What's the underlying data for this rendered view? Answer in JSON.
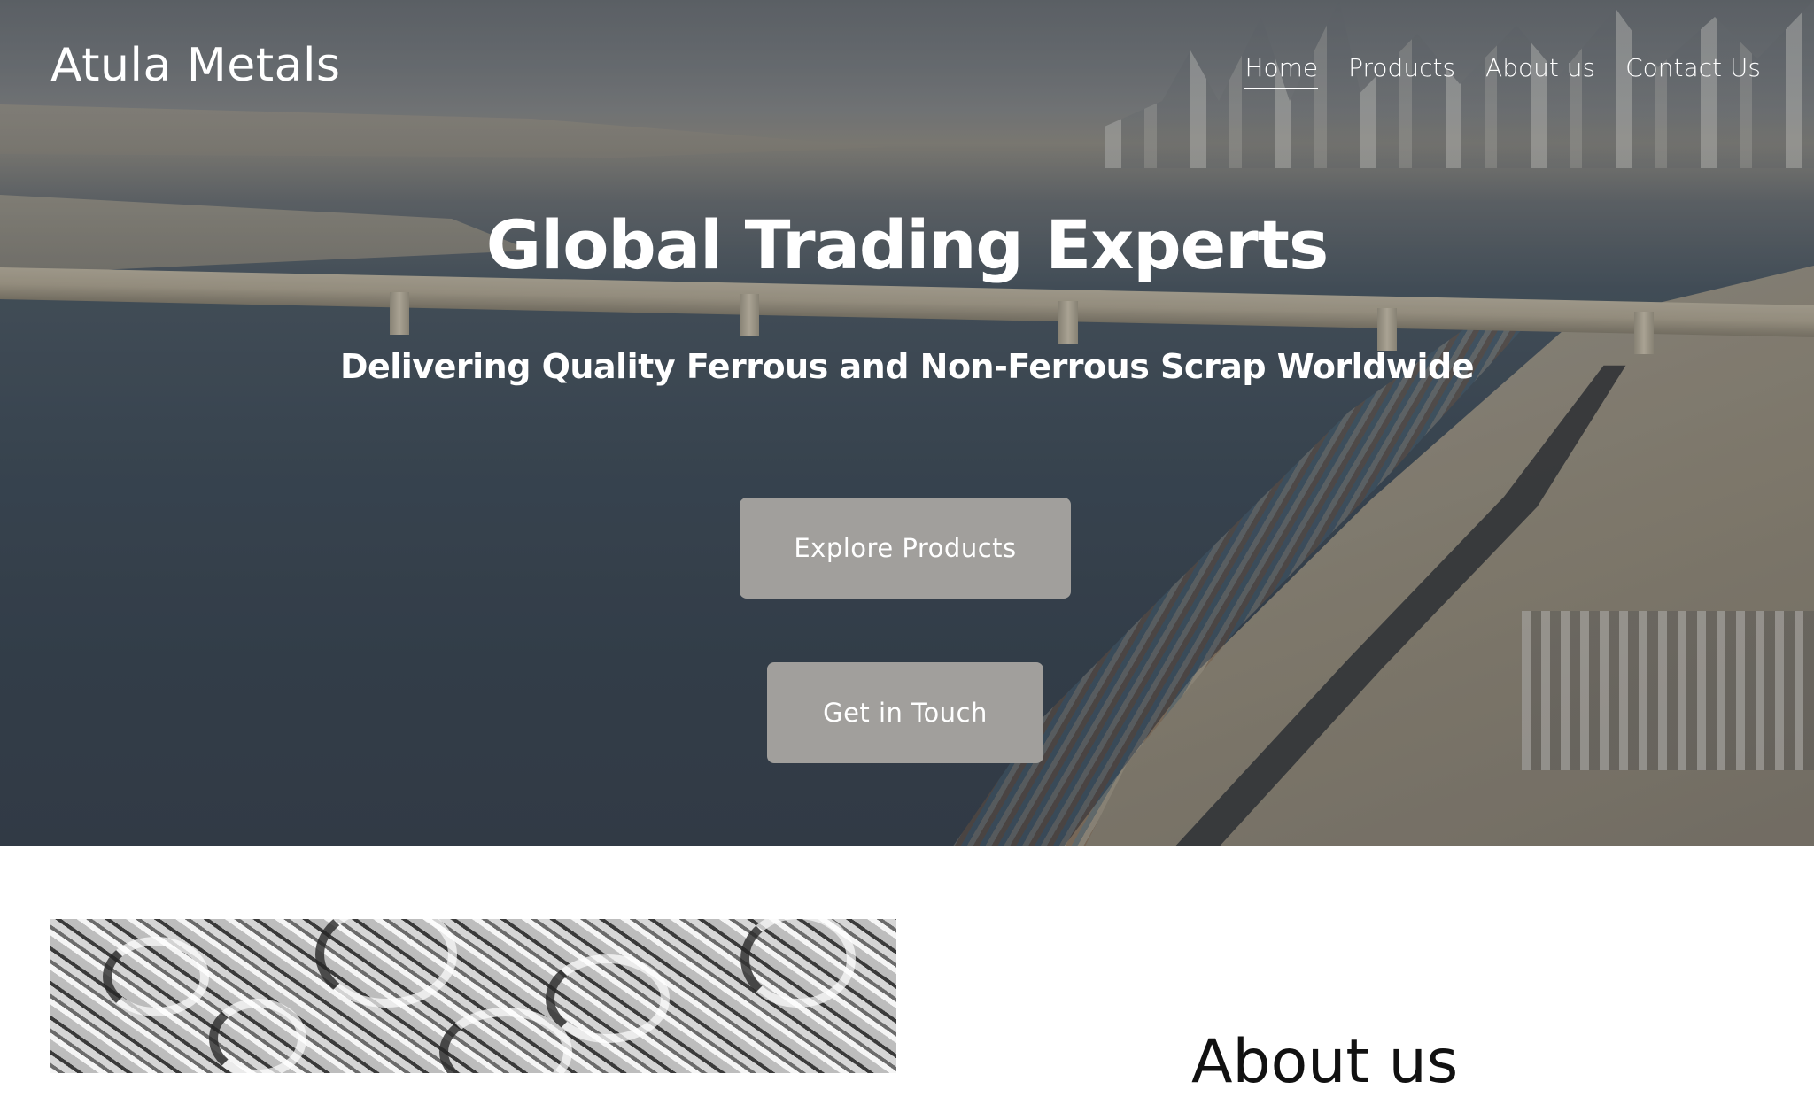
{
  "header": {
    "brand": "Atula Metals",
    "nav": [
      {
        "label": "Home",
        "active": true
      },
      {
        "label": "Products",
        "active": false
      },
      {
        "label": "About us",
        "active": false
      },
      {
        "label": "Contact Us",
        "active": false
      }
    ]
  },
  "hero": {
    "title": "Global Trading Experts",
    "subtitle": "Delivering Quality Ferrous and Non-Ferrous Scrap Worldwide",
    "primary_button": "Explore Products",
    "secondary_button": "Get in Touch",
    "button_color": "#a19f9c"
  },
  "about": {
    "heading": "About us"
  },
  "colors": {
    "text_on_hero": "#ffffff",
    "page_background": "#ffffff",
    "heading_dark": "#111111"
  }
}
